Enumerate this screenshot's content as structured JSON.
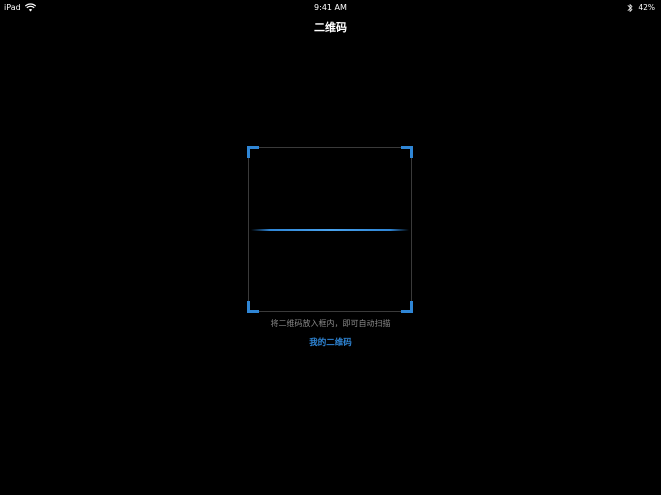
{
  "status_bar": {
    "carrier": "iPad",
    "wifi_icon": "wifi-icon",
    "time": "9:41 AM",
    "bluetooth_icon": "bluetooth-icon",
    "battery": "42%"
  },
  "nav": {
    "title": "二维码"
  },
  "scanner": {
    "hint": "将二维码放入框内，即可自动扫描",
    "my_qr_label": "我的二维码"
  },
  "colors": {
    "background": "#000000",
    "accent": "#2f86d6",
    "hint_text": "#8a8a8a",
    "frame_border": "#3a3a3a"
  }
}
